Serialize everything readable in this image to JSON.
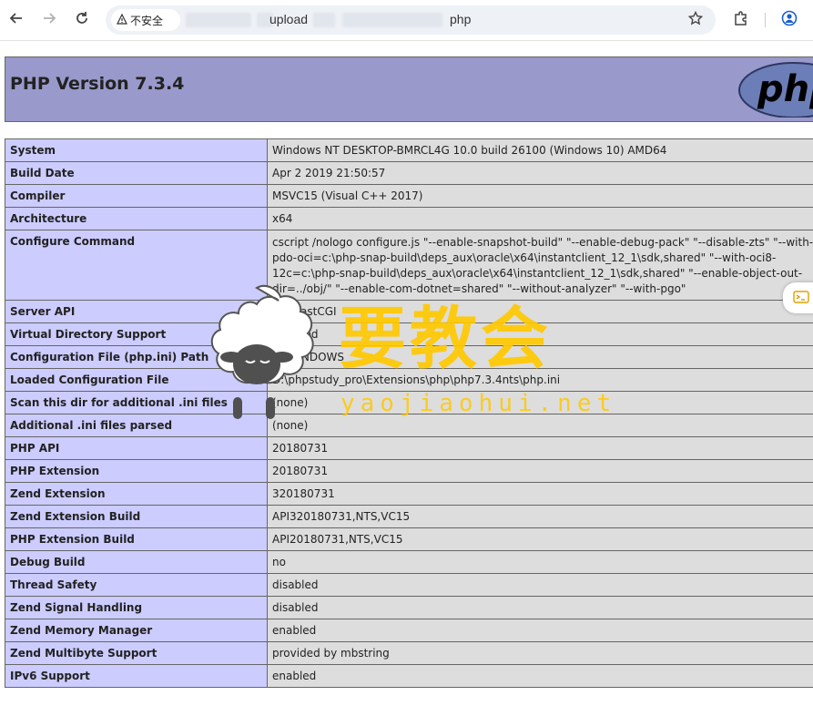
{
  "browser": {
    "security_label": "不安全",
    "url_part1": "upload",
    "url_part2": "php"
  },
  "page": {
    "title": "PHP Version 7.3.4",
    "logo_text": "php"
  },
  "rows": [
    {
      "key": "System",
      "value": "Windows NT DESKTOP-BMRCL4G 10.0 build 26100 (Windows 10) AMD64"
    },
    {
      "key": "Build Date",
      "value": "Apr 2 2019 21:50:57"
    },
    {
      "key": "Compiler",
      "value": "MSVC15 (Visual C++ 2017)"
    },
    {
      "key": "Architecture",
      "value": "x64"
    },
    {
      "key": "Configure Command",
      "value": "cscript /nologo configure.js \"--enable-snapshot-build\" \"--enable-debug-pack\" \"--disable-zts\" \"--with-pdo-oci=c:\\php-snap-build\\deps_aux\\oracle\\x64\\instantclient_12_1\\sdk,shared\" \"--with-oci8-12c=c:\\php-snap-build\\deps_aux\\oracle\\x64\\instantclient_12_1\\sdk,shared\" \"--enable-object-out-dir=../obj/\" \"--enable-com-dotnet=shared\" \"--without-analyzer\" \"--with-pgo\""
    },
    {
      "key": "Server API",
      "value": "CGI/FastCGI"
    },
    {
      "key": "Virtual Directory Support",
      "value": "disabled"
    },
    {
      "key": "Configuration File (php.ini) Path",
      "value": "C:\\WINDOWS"
    },
    {
      "key": "Loaded Configuration File",
      "value": "D:\\phpstudy_pro\\Extensions\\php\\php7.3.4nts\\php.ini"
    },
    {
      "key": "Scan this dir for additional .ini files",
      "value": "(none)"
    },
    {
      "key": "Additional .ini files parsed",
      "value": "(none)"
    },
    {
      "key": "PHP API",
      "value": "20180731"
    },
    {
      "key": "PHP Extension",
      "value": "20180731"
    },
    {
      "key": "Zend Extension",
      "value": "320180731"
    },
    {
      "key": "Zend Extension Build",
      "value": "API320180731,NTS,VC15"
    },
    {
      "key": "PHP Extension Build",
      "value": "API20180731,NTS,VC15"
    },
    {
      "key": "Debug Build",
      "value": "no"
    },
    {
      "key": "Thread Safety",
      "value": "disabled"
    },
    {
      "key": "Zend Signal Handling",
      "value": "disabled"
    },
    {
      "key": "Zend Memory Manager",
      "value": "enabled"
    },
    {
      "key": "Zend Multibyte Support",
      "value": "provided by mbstring"
    },
    {
      "key": "IPv6 Support",
      "value": "enabled"
    }
  ],
  "watermark": {
    "chinese": "要教会",
    "domain": "yaojiaohui.net"
  },
  "colors": {
    "header_bg": "#9999cc",
    "key_bg": "#ccccff",
    "value_bg": "#dddddd",
    "watermark": "#ffc800"
  },
  "icons": [
    "back-arrow-icon",
    "forward-arrow-icon",
    "reload-icon",
    "warning-icon",
    "star-icon",
    "extensions-icon",
    "profile-icon"
  ]
}
